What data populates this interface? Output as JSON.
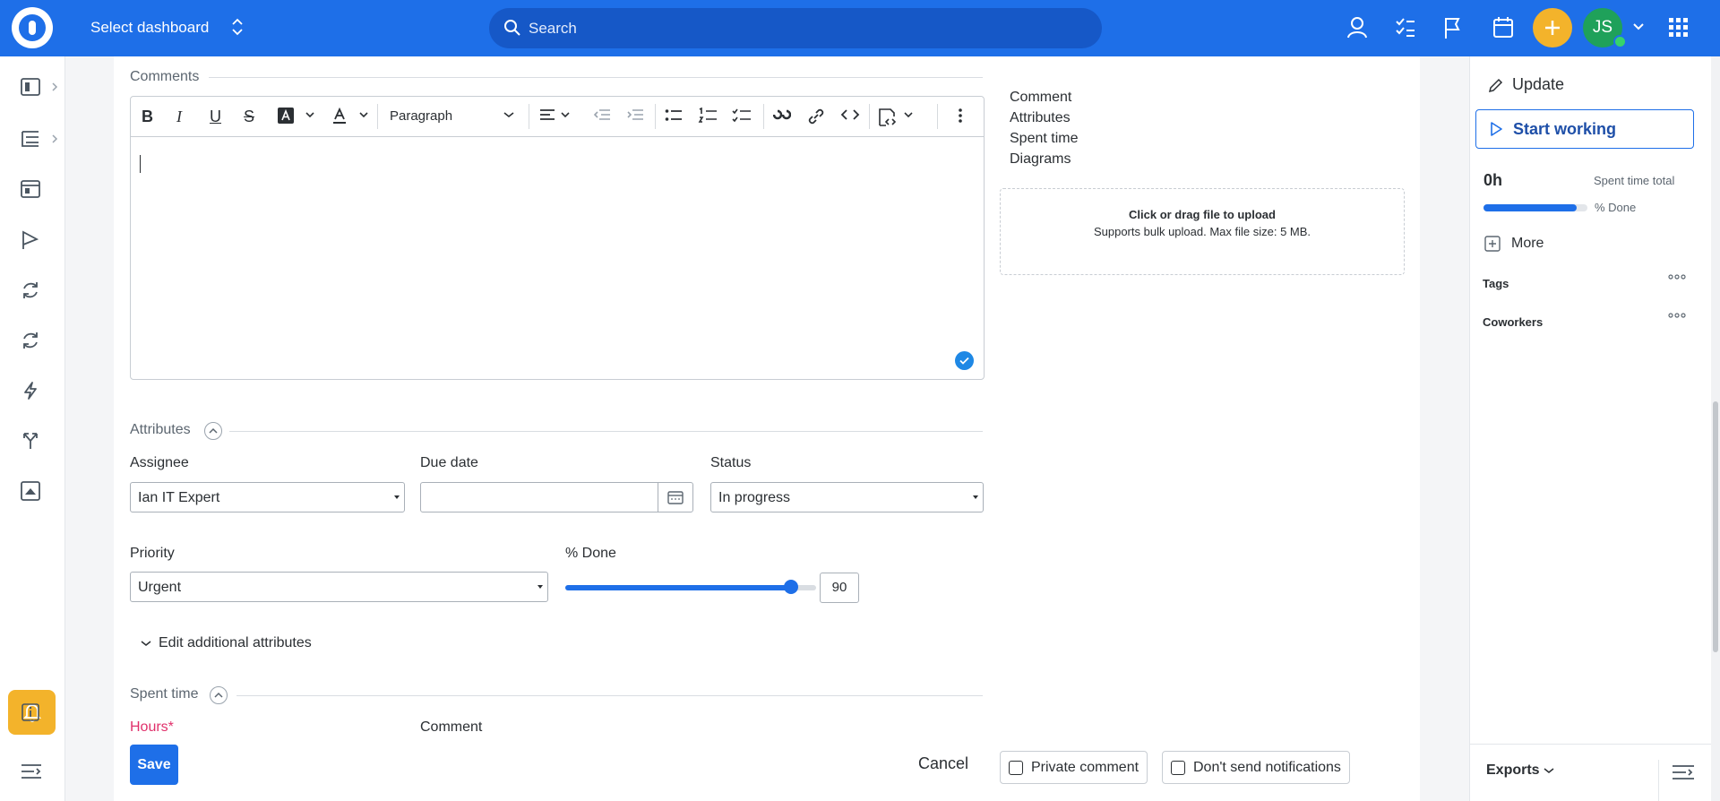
{
  "topbar": {
    "dashboard_label": "Select dashboard",
    "search_placeholder": "Search",
    "avatar_initials": "JS",
    "accent": "#1e6fe8"
  },
  "comments": {
    "section_title": "Comments",
    "paragraph_style": "Paragraph",
    "side_links": [
      "Comment",
      "Attributes",
      "Spent time",
      "Diagrams"
    ],
    "upload_title": "Click or drag file to upload",
    "upload_hint": "Supports bulk upload. Max file size: 5 MB."
  },
  "attributes": {
    "section_title": "Attributes",
    "assignee_label": "Assignee",
    "assignee_value": "Ian IT Expert",
    "due_date_label": "Due date",
    "due_date_value": "",
    "status_label": "Status",
    "status_value": "In progress",
    "priority_label": "Priority",
    "priority_value": "Urgent",
    "done_label": "% Done",
    "done_value": "90",
    "edit_additional": "Edit additional attributes"
  },
  "spent_time": {
    "section_title": "Spent time",
    "hours_label": "Hours*",
    "comment_label": "Comment"
  },
  "actions": {
    "save": "Save",
    "cancel": "Cancel",
    "private_comment": "Private comment",
    "dont_send": "Don't send notifications"
  },
  "right_panel": {
    "update": "Update",
    "start_working": "Start working",
    "spent_hours": "0h",
    "spent_total_label": "Spent time total",
    "done_label": "% Done",
    "done_fraction": 0.9,
    "more": "More",
    "tags": "Tags",
    "coworkers": "Coworkers",
    "exports": "Exports"
  }
}
